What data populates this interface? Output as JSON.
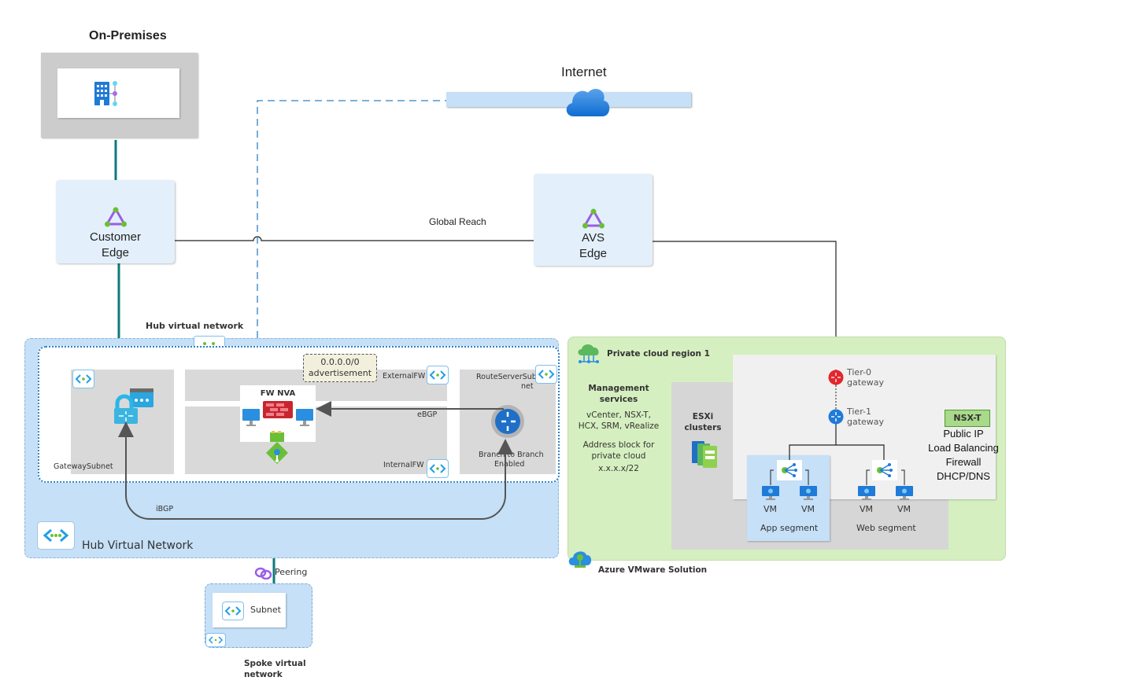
{
  "onprem": {
    "title": "On-Premises",
    "icon": "on-premises-building-icon"
  },
  "internet": {
    "label": "Internet",
    "icon": "cloud-icon"
  },
  "customer_edge": {
    "line1": "Customer",
    "line2": "Edge",
    "icon": "expressroute-circuit-icon"
  },
  "avs_edge": {
    "line1": "AVS",
    "line2": "Edge",
    "icon": "expressroute-circuit-icon"
  },
  "global_reach": {
    "label": "Global Reach"
  },
  "hub": {
    "header_label": "Hub virtual network",
    "footer_label": "Hub Virtual Network",
    "subnets": {
      "gateway": "GatewaySubnet",
      "external_fw": "ExternalFW",
      "internal_fw": "InternalFW",
      "route_server_line1": "RouteServerSub",
      "route_server_line2": "net"
    },
    "fw_nva": "FW NVA",
    "advertisement_line1": "0.0.0.0/0",
    "advertisement_line2": "advertisement",
    "ebgp": "eBGP",
    "ibgp": "iBGP",
    "branch_line1": "Branch to Branch",
    "branch_line2": "Enabled"
  },
  "spoke": {
    "peering": "Peering",
    "subnet": "Subnet",
    "title_line1": "Spoke virtual",
    "title_line2": "network"
  },
  "avs": {
    "region_title": "Private cloud region 1",
    "footer_title": "Azure VMware Solution",
    "mgmt_title_line1": "Management",
    "mgmt_title_line2": "services",
    "mgmt_line1": "vCenter, NSX-T,",
    "mgmt_line2": "HCX, SRM, vRealize",
    "addr_line1": "Address block for",
    "addr_line2": "private cloud",
    "addr_line3": "x.x.x.x/22",
    "esxi_line1": "ESXi",
    "esxi_line2": "clusters",
    "tier0_line1": "Tier-0",
    "tier0_line2": "gateway",
    "tier1_line1": "Tier-1",
    "tier1_line2": "gateway",
    "nsxt_badge": "NSX-T",
    "nsxt_features": [
      "Public IP",
      "Load Balancing",
      "Firewall",
      "DHCP/DNS"
    ],
    "vm_label": "VM",
    "app_segment": "App segment",
    "web_segment": "Web segment"
  },
  "colors": {
    "teal_line": "#0e7a7a",
    "dashed_blue": "#2f80c4",
    "hub_fill": "#c5e0f7",
    "avs_fill": "#d6efc0",
    "subnet_gray": "#d9d9d9",
    "nsxt_green": "#a9d98a"
  }
}
